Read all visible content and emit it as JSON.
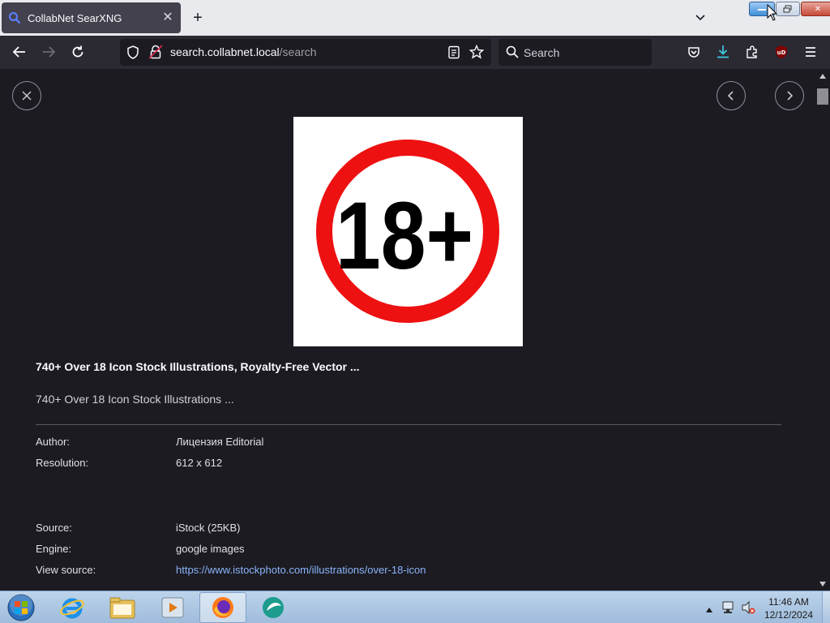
{
  "tab": {
    "title": "CollabNet SearXNG",
    "favicon": "search-icon"
  },
  "navbar": {
    "url_host": "search.collabnet.local",
    "url_path": "/search",
    "url_prefix": "",
    "search_placeholder": "Search"
  },
  "viewer": {
    "title": "740+ Over 18 Icon Stock Illustrations, Royalty-Free Vector ...",
    "description": "740+ Over 18 Icon Stock Illustrations ...",
    "image_text": "18+",
    "meta": {
      "author_label": "Author:",
      "author_value": "Лицензия Editorial",
      "resolution_label": "Resolution:",
      "resolution_value": "612 x 612",
      "source_label": "Source:",
      "source_value": "iStock (25KB)",
      "engine_label": "Engine:",
      "engine_value": "google images",
      "viewsource_label": "View source:",
      "viewsource_value": "https://www.istockphoto.com/illustrations/over-18-icon"
    }
  },
  "taskbar": {
    "time": "11:46 AM",
    "date": "12/12/2024"
  },
  "colors": {
    "accent_ring": "#ee1111",
    "link": "#8ab4f8",
    "page_bg": "#1c1b22"
  }
}
